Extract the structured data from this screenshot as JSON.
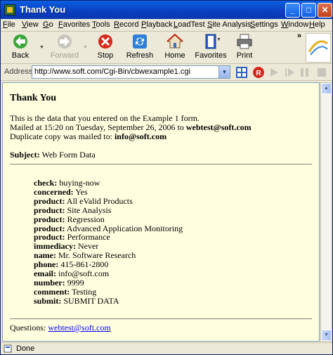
{
  "window": {
    "title": "Thank You"
  },
  "menu": [
    {
      "label": "File",
      "u": "F",
      "rest": "ile"
    },
    {
      "label": "View",
      "u": "V",
      "rest": "iew"
    },
    {
      "label": "Go",
      "u": "G",
      "rest": "o"
    },
    {
      "label": "Favorites",
      "u": "F",
      "rest": "avorites"
    },
    {
      "label": "Tools",
      "u": "T",
      "rest": "ools"
    },
    {
      "label": "Record",
      "u": "R",
      "rest": "ecord"
    },
    {
      "label": "Playback",
      "u": "P",
      "rest": "layback"
    },
    {
      "label": "LoadTest",
      "u": "L",
      "rest": "oadTest"
    },
    {
      "label": "Site Analysis",
      "u": "S",
      "rest": "ite Analysis"
    },
    {
      "label": "Settings",
      "u": "S",
      "rest": "ettings"
    },
    {
      "label": "Window",
      "u": "W",
      "rest": "indow"
    },
    {
      "label": "Help",
      "u": "H",
      "rest": "elp"
    }
  ],
  "toolbar": {
    "back": "Back",
    "forward": "Forward",
    "stop": "Stop",
    "refresh": "Refresh",
    "home": "Home",
    "favorites": "Favorites",
    "print": "Print",
    "more": "»"
  },
  "address": {
    "label": "Address",
    "url": "http://www.soft.com/Cgi-Bin/cbwexample1.cgi"
  },
  "page": {
    "heading": "Thank You",
    "intro_line1": "This is the data that you entered on the Example 1 form.",
    "mailed_prefix": "Mailed at 15:20 on Tuesday, September 26, 2006 to ",
    "mailed_to": "webtest@soft.com",
    "duplicate_prefix": "Duplicate copy was mailed to: ",
    "duplicate_to": "info@soft.com",
    "subject_label": "Subject:",
    "subject_value": " Web Form Data",
    "fields": [
      {
        "key": "check:",
        "value": " buying-now"
      },
      {
        "key": "concerned:",
        "value": " Yes"
      },
      {
        "key": "product:",
        "value": " All eValid Products"
      },
      {
        "key": "product:",
        "value": " Site Analysis"
      },
      {
        "key": "product:",
        "value": " Regression"
      },
      {
        "key": "product:",
        "value": " Advanced Application Monitoring"
      },
      {
        "key": "product:",
        "value": " Performance"
      },
      {
        "key": "immediacy:",
        "value": " Never"
      },
      {
        "key": "name:",
        "value": " Mr. Software Research"
      },
      {
        "key": "phone:",
        "value": " 415-861-2800"
      },
      {
        "key": "email:",
        "value": " info@soft.com"
      },
      {
        "key": "number:",
        "value": " 9999"
      },
      {
        "key": "comment:",
        "value": " Testing"
      },
      {
        "key": "submit:",
        "value": " SUBMIT DATA"
      }
    ],
    "questions_label": "Questions: ",
    "questions_link": "webtest@soft.com"
  },
  "status": {
    "text": "Done"
  }
}
